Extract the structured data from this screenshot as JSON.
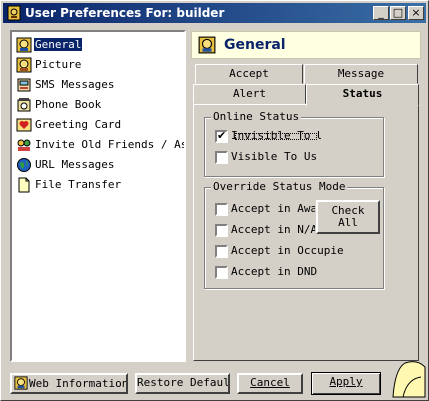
{
  "window": {
    "title": "User Preferences For: builder",
    "controls": [
      "_",
      "□",
      "×"
    ]
  },
  "sidebar": {
    "items": [
      {
        "label": "General",
        "icon": "user-face-icon",
        "selected": true
      },
      {
        "label": "Picture",
        "icon": "picture-icon",
        "selected": false
      },
      {
        "label": "SMS Messages",
        "icon": "sms-phone-icon",
        "selected": false
      },
      {
        "label": "Phone Book",
        "icon": "phone-book-icon",
        "selected": false
      },
      {
        "label": "Greeting Card",
        "icon": "greeting-card-icon",
        "selected": false
      },
      {
        "label": "Invite Old Friends / Asso",
        "icon": "invite-friends-icon",
        "selected": false
      },
      {
        "label": "URL Messages",
        "icon": "globe-icon",
        "selected": false
      },
      {
        "label": "File Transfer",
        "icon": "file-icon",
        "selected": false
      }
    ]
  },
  "header": {
    "title": "General",
    "icon": "user-face-icon"
  },
  "tabs": {
    "row1": [
      "Accept",
      "Message"
    ],
    "row2": [
      "Alert",
      "Status"
    ],
    "active": "Status"
  },
  "online_status": {
    "legend": "Online Status",
    "options": [
      {
        "label": "Invisible To U",
        "checked": true
      },
      {
        "label": "Visible To Us",
        "checked": false
      }
    ]
  },
  "override": {
    "legend": "Override Status Mode",
    "options": [
      {
        "label": "Accept in Away",
        "checked": false
      },
      {
        "label": "Accept in N/A",
        "checked": false
      },
      {
        "label": "Accept in Occupie",
        "checked": false
      },
      {
        "label": "Accept in DND",
        "checked": false
      }
    ],
    "check_all": [
      "Check",
      "All"
    ]
  },
  "footer": {
    "web_info": "Web Information",
    "restore": "Restore Defaults",
    "cancel": "Cancel",
    "apply": "Apply"
  },
  "colors": {
    "titlebar_start": "#0a246a",
    "titlebar_end": "#3a6ea5",
    "face": "#d4d0c8",
    "selection": "#0a246a",
    "header_bg": "#ffffe1"
  }
}
